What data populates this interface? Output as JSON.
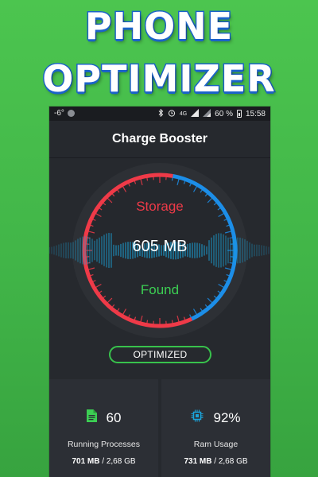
{
  "promo": {
    "line1": "PHONE",
    "line2": "OPTIMIZER"
  },
  "status_bar": {
    "left_text": "-6°",
    "battery": "60 %",
    "time": "15:58",
    "network": "4G"
  },
  "app_bar": {
    "title": "Charge Booster"
  },
  "gauge": {
    "top_label": "Storage",
    "value": "605 MB",
    "bottom_label": "Found",
    "colors": {
      "red": "#ef3a48",
      "blue": "#1c8ee8",
      "green": "#3ccf53",
      "wave": "#1aa3d9"
    }
  },
  "optimize_button": {
    "label": "OPTIMIZED"
  },
  "cards": [
    {
      "icon": "file-icon",
      "value": "60",
      "label": "Running Processes",
      "sub_used": "701 MB",
      "sub_total": "2,68 GB"
    },
    {
      "icon": "cpu-chip-icon",
      "value": "92%",
      "label": "Ram Usage",
      "sub_used": "731 MB",
      "sub_total": "2,68 GB"
    }
  ]
}
